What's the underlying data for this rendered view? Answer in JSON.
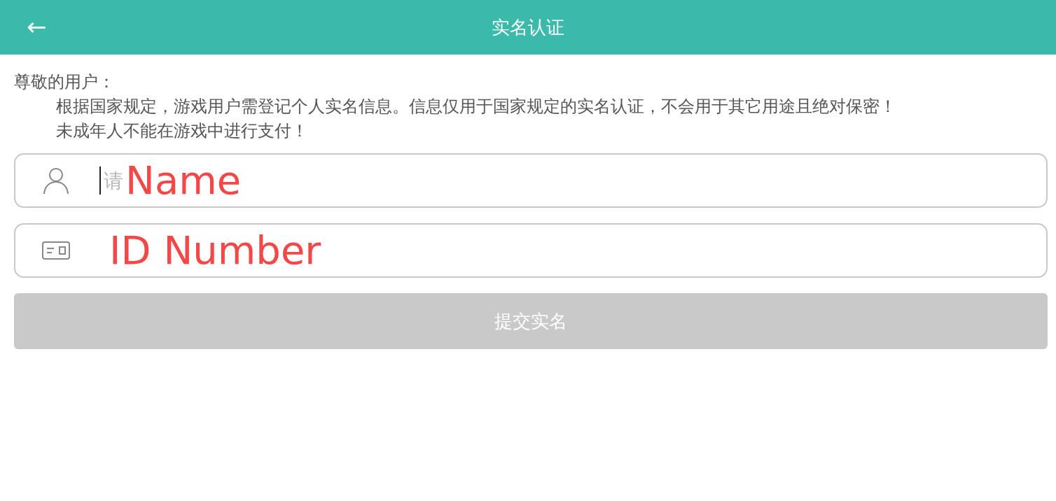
{
  "header": {
    "back": "←",
    "title": "实名认证"
  },
  "notice": {
    "greeting": "尊敬的用户：",
    "lines": [
      "根据国家规定，游戏用户需登记个人实名信息。信息仅用于国家规定的实名认证，不会用于其它用途且绝对保密！",
      "未成年人不能在游戏中进行支付！"
    ]
  },
  "fields": [
    {
      "kind": "person",
      "placeholder": "请",
      "focused": true,
      "annotation": "Name"
    },
    {
      "kind": "card",
      "focused": false,
      "annotation": "ID Number"
    }
  ],
  "submit": {
    "label": "提交实名",
    "disabled": true
  }
}
